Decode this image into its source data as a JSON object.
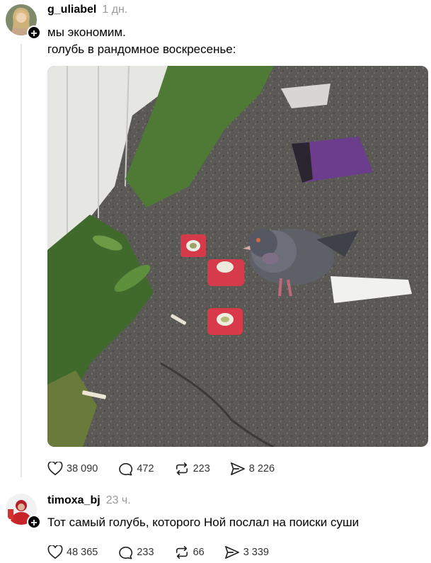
{
  "post1": {
    "username": "g_uliabel",
    "time": "1 дн.",
    "lines": [
      "мы экономим.",
      "голубь в рандомное воскресенье:"
    ],
    "stats": {
      "likes": "38 090",
      "comments": "472",
      "reposts": "223",
      "shares": "8 226"
    }
  },
  "post2": {
    "username": "timoxa_bj",
    "time": "23 ч.",
    "text": "Тот самый голубь, которого Ной послал на поиски суши",
    "stats": {
      "likes": "48 365",
      "comments": "233",
      "reposts": "66",
      "shares": "3 339"
    }
  },
  "icons": {
    "like": "heart-icon",
    "comment": "comment-bubble-icon",
    "repost": "repost-icon",
    "share": "send-icon",
    "follow": "plus-icon"
  }
}
